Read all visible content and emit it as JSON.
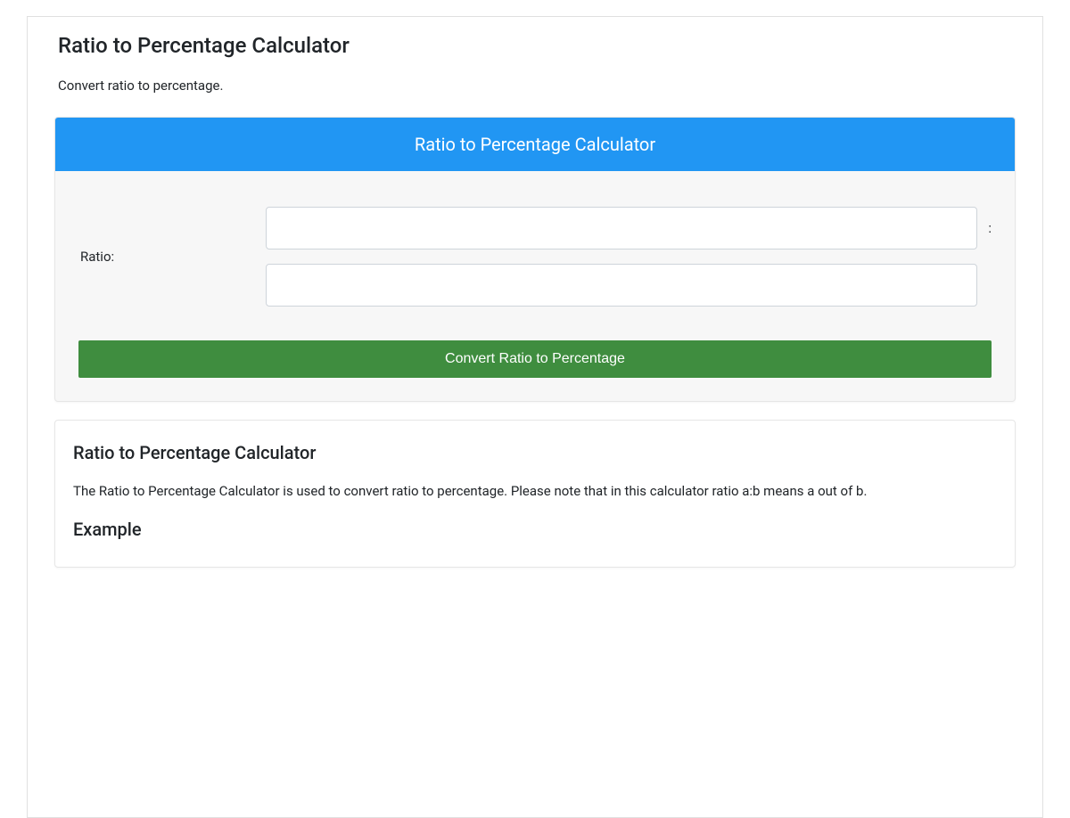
{
  "header": {
    "title": "Ratio to Percentage Calculator",
    "subtitle": "Convert ratio to percentage."
  },
  "calculator": {
    "card_title": "Ratio to Percentage Calculator",
    "label": "Ratio:",
    "separator": ":",
    "input_a_value": "",
    "input_b_value": "",
    "button_label": "Convert Ratio to Percentage"
  },
  "info": {
    "heading": "Ratio to Percentage Calculator",
    "paragraph": "The Ratio to Percentage Calculator is used to convert ratio to percentage. Please note that in this calculator ratio a:b means a out of b.",
    "example_heading": "Example"
  }
}
